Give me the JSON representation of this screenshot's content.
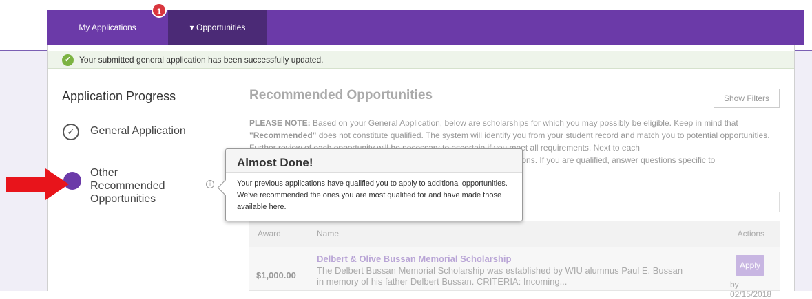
{
  "nav": {
    "tab_my_apps": "My Applications",
    "tab_opportunities": "▾ Opportunities",
    "badge_count": "1"
  },
  "alert": {
    "message": "Your submitted general application has been successfully updated.",
    "icon": "check-circle-icon"
  },
  "sidebar": {
    "title": "Application Progress",
    "steps": [
      {
        "label": "General Application",
        "status": "complete"
      },
      {
        "label": "Other Recommended Opportunities",
        "status": "current"
      }
    ]
  },
  "main": {
    "title": "Recommended Opportunities",
    "show_filters_label": "Show Filters",
    "note_prefix": "PLEASE NOTE:",
    "note_text_1": " Based on your General Application, below are scholarships for which you may possibly be eligible. Keep in mind that ",
    "note_recommended": "\"Recommended\"",
    "note_text_2": " does not constitute qualified. The system will identify you from your student record and match you to potential opportunities. Further review of each opportunity will be necessary to ascertain if you meet all requirements. Next to each",
    "note_text_3": "and questions. If you are qualified, answer questions specific to",
    "table": {
      "headers": {
        "award": "Award",
        "name": "Name",
        "actions": "Actions"
      },
      "rows": [
        {
          "award": "$1,000.00",
          "name": "Delbert & Olive Bussan Memorial Scholarship",
          "description": "The Delbert Bussan Memorial Scholarship was established by WIU alumnus Paul E. Bussan in memory of his father Delbert Bussan. CRITERIA: Incoming...",
          "apply_label": "Apply",
          "deadline": "by 02/15/2018"
        }
      ]
    }
  },
  "popover": {
    "title": "Almost Done!",
    "body": "Your previous applications have qualified you to apply to additional opportunities. We've recommended the ones you are most qualified for and have made those available here."
  },
  "colors": {
    "nav_purple": "#6b3aa8",
    "nav_dark": "#4b2a76",
    "badge_red": "#d9363e",
    "success_green": "#7cb342",
    "annotation_arrow": "#e8141b"
  }
}
